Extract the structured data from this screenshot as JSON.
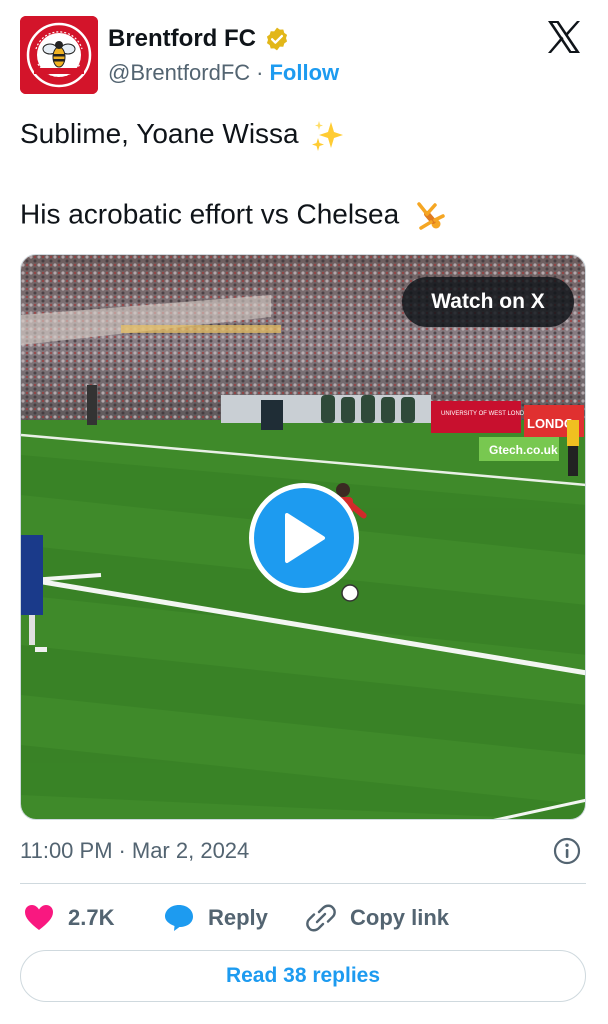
{
  "author": {
    "display_name": "Brentford FC",
    "handle": "@BrentfordFC",
    "separator": "·",
    "follow_label": "Follow",
    "verified_color": "#e2b719",
    "avatar_ring_text": "BRENTFORD · FOOTBALL CLUB"
  },
  "tweet": {
    "line1": "Sublime, Yoane Wissa",
    "line1_emoji": "sparkles-emoji",
    "line2": "His acrobatic effort vs Chelsea",
    "line2_emoji": "person-cartwheeling-emoji"
  },
  "media": {
    "watch_label": "Watch on X",
    "play_icon": "play-icon",
    "ad_boards": [
      "UNIVERSITY OF WEST LONDON",
      "LONDO",
      "Gtech.co.uk"
    ]
  },
  "meta": {
    "time": "11:00 PM",
    "separator": "·",
    "date": "Mar 2, 2024"
  },
  "actions": {
    "like_count": "2.7K",
    "reply_label": "Reply",
    "copy_link_label": "Copy link",
    "read_replies_label": "Read 38 replies"
  },
  "colors": {
    "accent": "#1d9bf0",
    "like": "#f91880",
    "text": "#0f1419",
    "muted": "#536471",
    "brand_red": "#d3142a"
  }
}
